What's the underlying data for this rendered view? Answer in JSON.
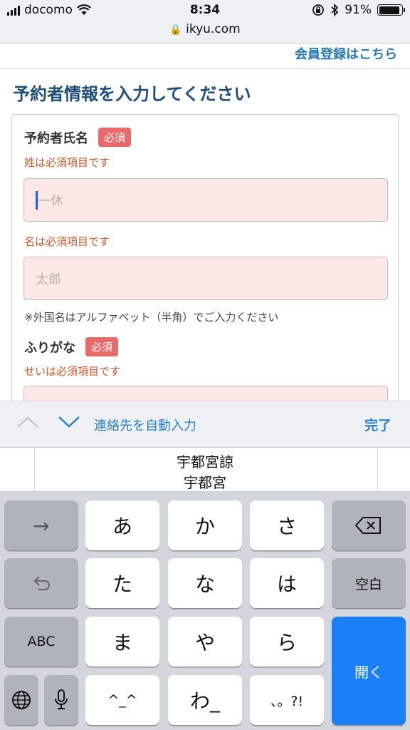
{
  "status_bar": {
    "carrier": "docomo",
    "time": "8:34",
    "battery": "91%",
    "battery_level": 0.91,
    "url": "ikyu.com"
  },
  "page": {
    "member_link": "会員登録はこちら",
    "title": "予約者情報を入力してください",
    "fields": {
      "name_label": "予約者氏名",
      "required_badge": "必須",
      "last_name_error": "姓は必須項目です",
      "last_name_placeholder": "一休",
      "first_name_error": "名は必須項目です",
      "first_name_placeholder": "太郎",
      "foreign_note": "※外国名はアルファベット（半角）でご入力ください",
      "furigana_label": "ふりがな",
      "furigana_error": "せいは必須項目です"
    }
  },
  "accessory_bar": {
    "autofill": "連絡先を自動入力",
    "done": "完了"
  },
  "candidates": [
    "宇都宮諒",
    "宇都宮"
  ],
  "keyboard": {
    "row1": [
      "→",
      "あ",
      "か",
      "さ",
      "⌫"
    ],
    "row2": [
      "↺",
      "た",
      "な",
      "は",
      "空白"
    ],
    "row3": [
      "ABC",
      "ま",
      "や",
      "ら"
    ],
    "row4": [
      "^_^",
      "わ_",
      "、。?!"
    ],
    "enter": "開く"
  }
}
